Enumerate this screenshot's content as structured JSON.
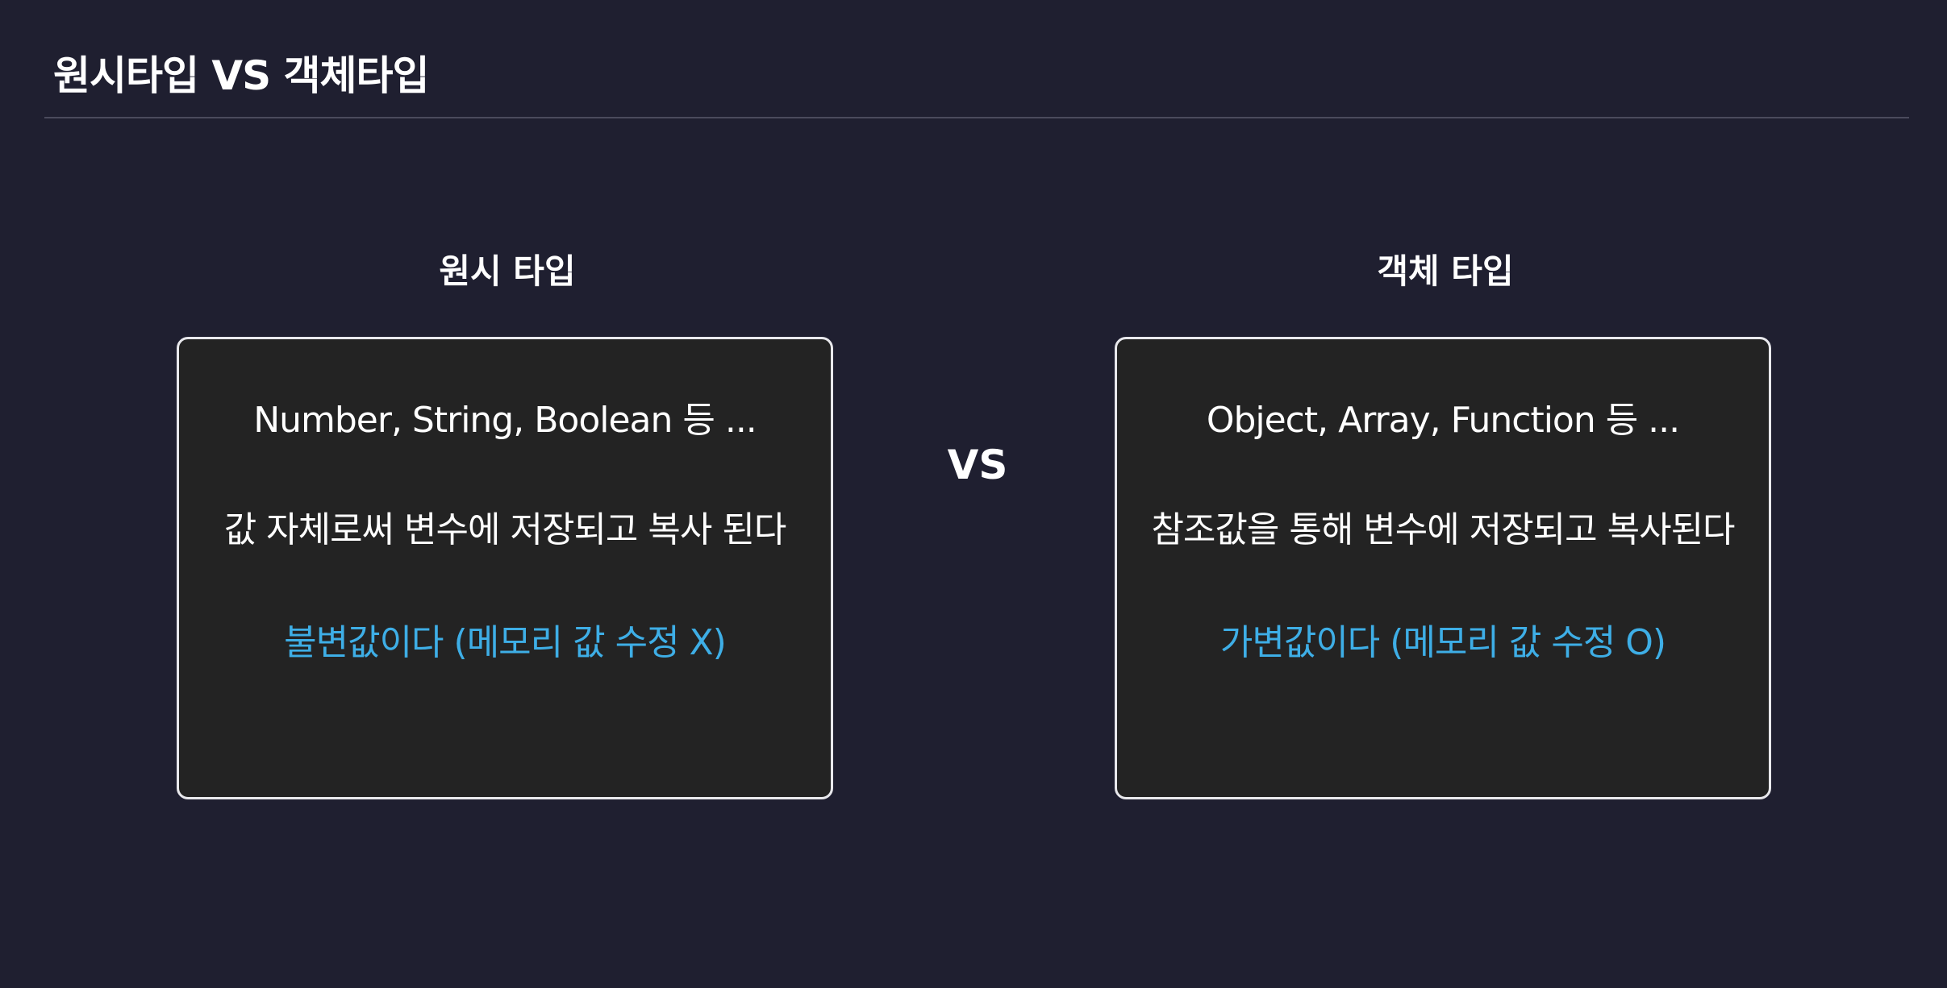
{
  "slide": {
    "title": "원시타입 VS 객체타입",
    "vs_label": "VS"
  },
  "primitive": {
    "heading": "원시 타입",
    "examples": "Number, String, Boolean 등 ...",
    "description": "값 자체로써 변수에 저장되고 복사 된다",
    "mutability": "불변값이다 (메모리 값 수정 X)"
  },
  "object": {
    "heading": "객체 타입",
    "examples": "Object, Array, Function 등 ...",
    "description": "참조값을 통해 변수에 저장되고 복사된다",
    "mutability": "가변값이다 (메모리 값 수정 O)"
  },
  "colors": {
    "background": "#1f1f30",
    "card_background": "#232323",
    "card_border": "#e8e8ec",
    "accent": "#3eaee6",
    "text": "#ffffff"
  }
}
